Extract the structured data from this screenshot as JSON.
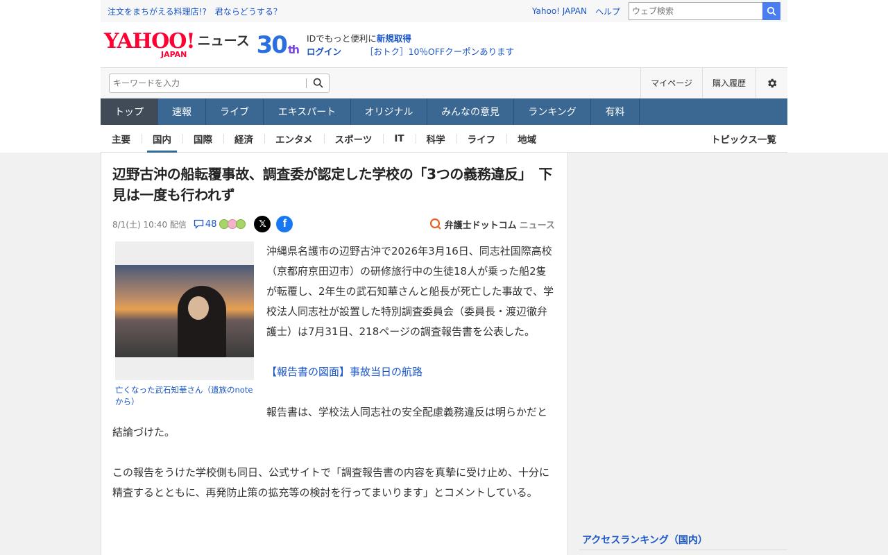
{
  "promo": {
    "text": "注文をまちがえる料理店!?　君ならどうする？",
    "links": [
      "Yahoo! JAPAN",
      "ヘルプ"
    ],
    "search_placeholder": "ウェブ検索"
  },
  "masthead": {
    "logo_text": "YAHOO!",
    "logo_sub": "JAPAN",
    "section": "ニュース",
    "anniversary": "30",
    "anniversary_suffix": "th",
    "id_text": "IDでもっと便利に",
    "signup": "新規取得",
    "login": "ログイン",
    "coupon": "［おトク］10％OFFクーポンあります"
  },
  "toolbar": {
    "keyword_placeholder": "キーワードを入力",
    "mypage": "マイページ",
    "history": "購入履歴"
  },
  "gnav": [
    {
      "label": "トップ",
      "w": 83,
      "active": true
    },
    {
      "label": "速報",
      "w": 69
    },
    {
      "label": "ライブ",
      "w": 83
    },
    {
      "label": "エキスパート",
      "w": 126
    },
    {
      "label": "オリジナル",
      "w": 110
    },
    {
      "label": "みんなの意見",
      "w": 125
    },
    {
      "label": "ランキング",
      "w": 111
    },
    {
      "label": "有料",
      "w": 70
    }
  ],
  "cats": [
    "主要",
    "国内",
    "国際",
    "経済",
    "エンタメ",
    "スポーツ",
    "IT",
    "科学",
    "ライフ",
    "地域"
  ],
  "cats_all": "トピックス一覧",
  "article": {
    "title": "辺野古沖の船転覆事故、調査委が認定した学校の「3つの義務違反」　下見は一度も行われず",
    "date": "8/1(土) 10:40",
    "date_suffix": "配信",
    "comments": "48",
    "sns_x": "𝕏",
    "sns_fb": "f",
    "source_main": "弁護士ドットコム",
    "source_sub": "ニュース",
    "caption": "亡くなった武石知華さん（遺族のnoteから）",
    "p1": "沖縄県名護市の辺野古沖で2026年3月16日、同志社国際高校（京都府京田辺市）の研修旅行中の生徒18人が乗った船2隻が転覆し、2年生の武石知華さんと船長が死亡した事故で、学校法人同志社が設置した特別調査委員会（委員長・渡辺徹弁護士）は7月31日、218ページの調査報告書を公表した。",
    "link": "【報告書の図面】事故当日の航路",
    "p2": "報告書は、学校法人同志社の安全配慮義務違反は明らかだと結論づけた。",
    "p3": "この報告をうけた学校側も同日、公式サイトで「調査報告書の内容を真摯に受け止め、十分に精査するとともに、再発防止策の拡充等の検討を行ってまいります」とコメントしている。"
  },
  "side": {
    "ranking_title": "アクセスランキング（国内）"
  }
}
